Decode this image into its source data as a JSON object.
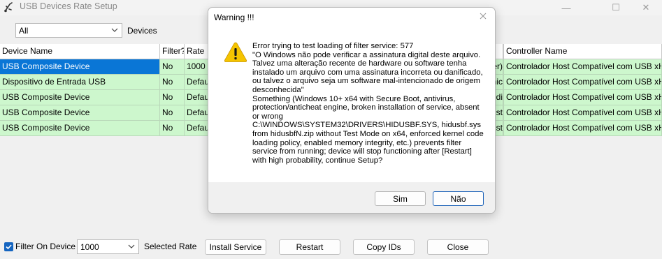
{
  "window": {
    "title": "USB Devices Rate Setup",
    "minimize_glyph": "—",
    "maximize_glyph": "☐",
    "close_glyph": "✕"
  },
  "filter": {
    "device_type_value": "All",
    "devices_label": "Devices"
  },
  "table": {
    "columns": [
      "Device Name",
      "Filter?",
      "Rate",
      "Controller Name"
    ],
    "hidden_column_fragments": [
      "er)",
      "hic",
      "di",
      "ist"
    ],
    "rows": [
      {
        "device": "USB Composite Device",
        "filter": "No",
        "rate": "1000",
        "controller": "Controlador Host Compatível com USB xHCI - A",
        "selected": true
      },
      {
        "device": "Dispositivo de Entrada USB",
        "filter": "No",
        "rate": "Default",
        "controller": "Controlador Host Compatível com USB xHCI - A",
        "selected": false
      },
      {
        "device": "USB Composite Device",
        "filter": "No",
        "rate": "Default",
        "controller": "Controlador Host Compatível com USB xHCI - A",
        "selected": false
      },
      {
        "device": "USB Composite Device",
        "filter": "No",
        "rate": "Default",
        "controller": "Controlador Host Compatível com USB xHCI - A",
        "selected": false
      },
      {
        "device": "USB Composite Device",
        "filter": "No",
        "rate": "Default",
        "controller": "Controlador Host Compatível com USB xHCI - A",
        "selected": false
      }
    ]
  },
  "bottom": {
    "filter_on_device_label": "Filter On Device",
    "filter_on_device_checked": true,
    "rate_value": "1000",
    "selected_rate_label": "Selected Rate",
    "install_service": "Install Service",
    "restart": "Restart",
    "copy_ids": "Copy IDs",
    "close": "Close"
  },
  "dialog": {
    "title": "Warning !!!",
    "icon": "warning-icon",
    "message": "Error trying to test loading of filter service: 577\n\"O Windows não pode verificar a assinatura digital deste arquivo. Talvez uma alteração recente de hardware ou software tenha instalado um arquivo com uma assinatura incorreta ou danificado, ou talvez o arquivo seja um software mal-intencionado de origem desconhecida\"\nSomething (Windows 10+ x64 with Secure Boot, antivirus, protection/anticheat engine, broken installation of service, absent or wrong\nC:\\WINDOWS\\SYSTEM32\\DRIVERS\\HIDUSBF.SYS, hidusbf.sys from hidusbfN.zip without Test Mode on x64, enforced kernel code loading policy, enabled memory integrity, etc.) prevents filter service from running; device will stop functioning after [Restart] with high probability, continue Setup?",
    "yes_label": "Sim",
    "no_label": "Não"
  },
  "colors": {
    "row_green": "#cdf7cd",
    "selected_blue": "#0a76d6",
    "warning_yellow": "#f5c400",
    "checkbox_blue": "#1565c0"
  }
}
